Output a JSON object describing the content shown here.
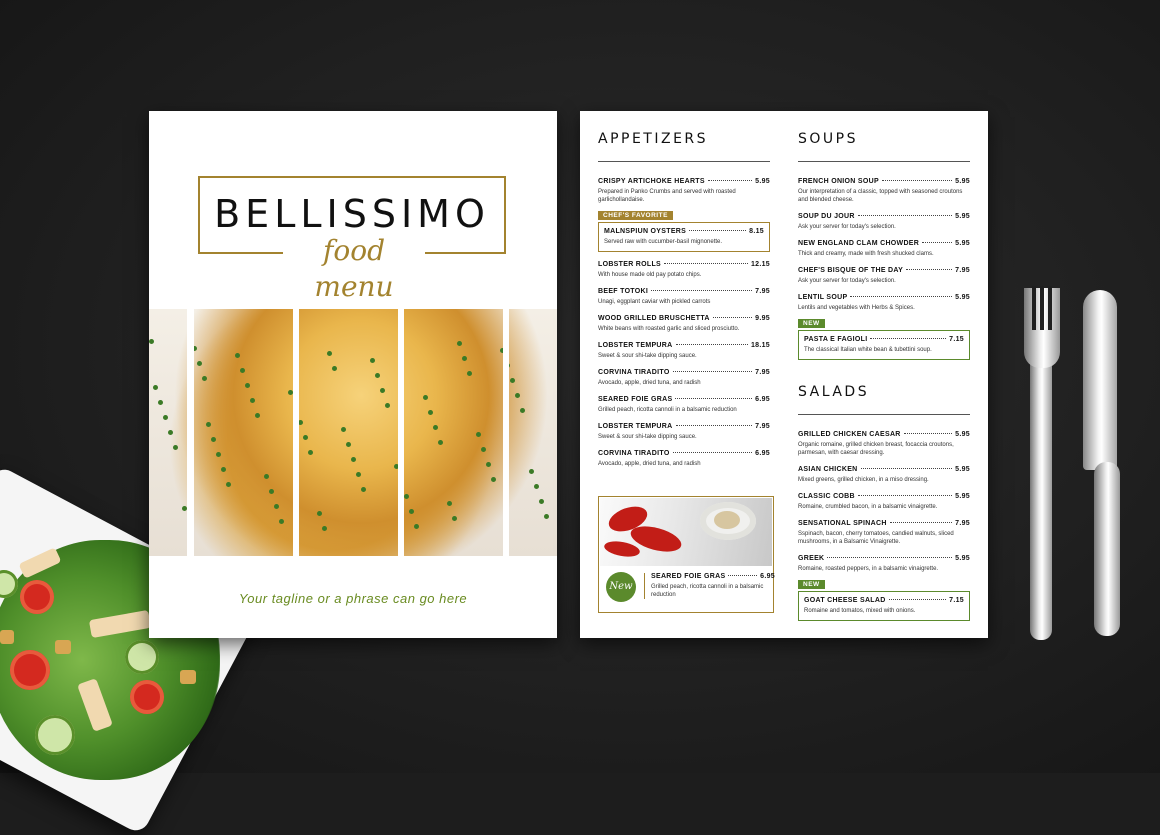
{
  "cover": {
    "title": "BELLISSIMO",
    "subtitle": "food menu",
    "tagline": "Your tagline or a phrase can go here"
  },
  "appetizers": {
    "heading": "APPETIZERS",
    "items": [
      {
        "name": "CRISPY ARTICHOKE HEARTS",
        "price": "5.95",
        "desc": "Prepared in Panko Crumbs and served with roasted garlichollandaise."
      },
      {
        "name": "MALNSPIUN OYSTERS",
        "price": "8.15",
        "desc": "Served raw with cucumber-basil mignonette.",
        "badge": "CHEF'S FAVORITE"
      },
      {
        "name": "LOBSTER ROLLS",
        "price": "12.15",
        "desc": "With house made old pay potato chips."
      },
      {
        "name": "BEEF TOTOKI",
        "price": "7.95",
        "desc": "Unagi, eggplant caviar with pickled carrots"
      },
      {
        "name": "WOOD GRILLED BRUSCHETTA",
        "price": "9.95",
        "desc": "White beans with roasted garlic and sliced prosciutto."
      },
      {
        "name": "LOBSTER TEMPURA",
        "price": "18.15",
        "desc": "Sweet & sour shi-take dipping sauce."
      },
      {
        "name": "CORVINA TIRADITO",
        "price": "7.95",
        "desc": "Avocado, apple, dried tuna, and radish"
      },
      {
        "name": "SEARED FOIE GRAS",
        "price": "6.95",
        "desc": "Grilled peach, ricotta cannoli in a balsamic reduction"
      },
      {
        "name": "LOBSTER TEMPURA",
        "price": "7.95",
        "desc": "Sweet & sour shi-take dipping sauce."
      },
      {
        "name": "CORVINA TIRADITO",
        "price": "6.95",
        "desc": "Avocado, apple, dried tuna, and radish"
      }
    ],
    "feature": {
      "badge": "New",
      "name": "SEARED FOIE GRAS",
      "price": "6.95",
      "desc": "Grilled peach, ricotta cannoli in a balsamic reduction"
    }
  },
  "soups": {
    "heading": "SOUPS",
    "items": [
      {
        "name": "FRENCH ONION SOUP",
        "price": "5.95",
        "desc": "Our interpretation of a classic, topped with seasoned croutons and blended cheese."
      },
      {
        "name": "SOUP DU JOUR",
        "price": "5.95",
        "desc": "Ask your server for today's selection."
      },
      {
        "name": "NEW ENGLAND CLAM CHOWDER",
        "price": "5.95",
        "desc": "Thick and creamy, made with fresh shucked clams."
      },
      {
        "name": "CHEF'S BISQUE OF THE DAY",
        "price": "7.95",
        "desc": "Ask your server for today's selection."
      },
      {
        "name": "LENTIL SOUP",
        "price": "5.95",
        "desc": "Lentils and vegetables with Herbs & Spices."
      },
      {
        "name": "PASTA E FAGIOLI",
        "price": "7.15",
        "desc": "The classical Italian white bean & tubettini soup.",
        "badge": "NEW"
      }
    ]
  },
  "salads": {
    "heading": "SALADS",
    "items": [
      {
        "name": "GRILLED CHICKEN CAESAR",
        "price": "5.95",
        "desc": "Organic romaine, grilled chicken breast, focaccia croutons, parmesan, with caesar dressing."
      },
      {
        "name": "ASIAN CHICKEN",
        "price": "5.95",
        "desc": "Mixed greens, grilled chicken, in a miso dressing."
      },
      {
        "name": "CLASSIC COBB",
        "price": "5.95",
        "desc": "Romaine, crumbled bacon, in a balsamic vinaigrette."
      },
      {
        "name": "SENSATIONAL SPINACH",
        "price": "7.95",
        "desc": "Sspinach, bacon, cherry tomatoes, candied walnuts, sliced mushrooms, in a Balsamic Vinaigrette."
      },
      {
        "name": "GREEK",
        "price": "5.95",
        "desc": "Romaine, roasted peppers, in a balsamic vinaigrette."
      },
      {
        "name": "GOAT CHEESE SALAD",
        "price": "7.15",
        "desc": "Romaine and tomatos, mixed with onions.",
        "badge": "NEW"
      }
    ]
  },
  "colors": {
    "gold": "#a3832f",
    "green": "#5b8a2c",
    "background": "#1d1d1d"
  }
}
